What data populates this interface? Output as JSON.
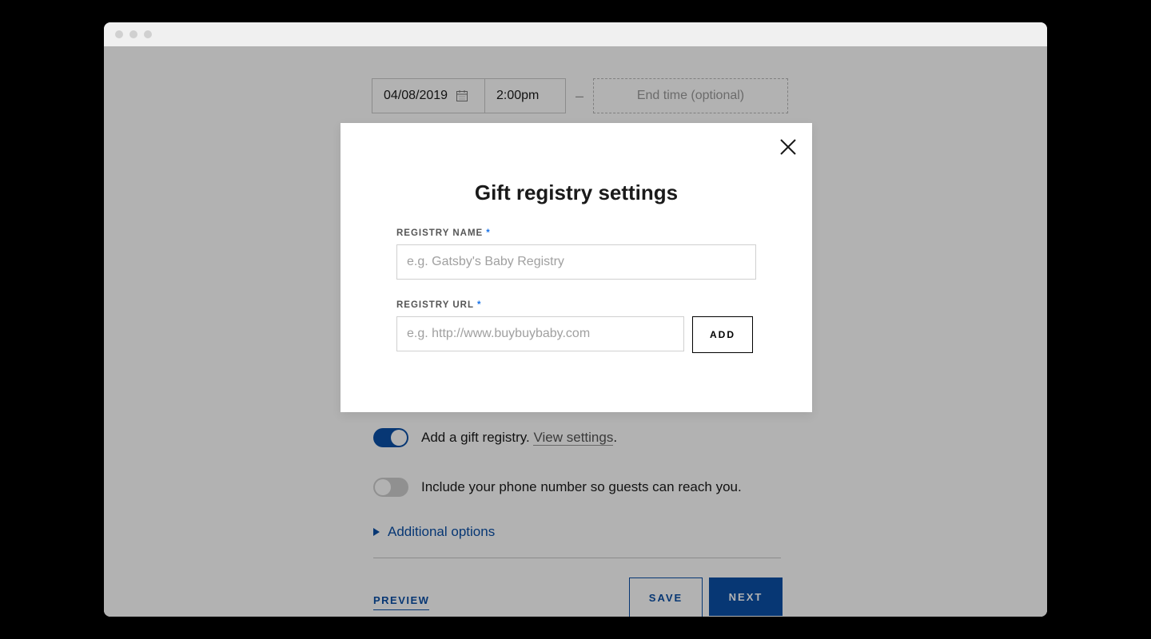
{
  "datetime": {
    "date": "04/08/2019",
    "time": "2:00pm",
    "end_placeholder": "End time (optional)"
  },
  "toggles": {
    "gift_registry_on": true,
    "gift_registry_label": "Add a gift registry.",
    "gift_registry_link": "View settings",
    "gift_registry_period": ".",
    "phone_on": false,
    "phone_label": "Include your phone number so guests can reach you."
  },
  "options": {
    "additional": "Additional options"
  },
  "footer": {
    "preview": "PREVIEW",
    "save": "SAVE",
    "next": "NEXT"
  },
  "modal": {
    "title": "Gift registry settings",
    "name_label": "REGISTRY NAME",
    "name_required": "*",
    "name_placeholder": "e.g. Gatsby's Baby Registry",
    "url_label": "REGISTRY URL",
    "url_required": "*",
    "url_placeholder": "e.g. http://www.buybuybaby.com",
    "add_button": "ADD"
  }
}
